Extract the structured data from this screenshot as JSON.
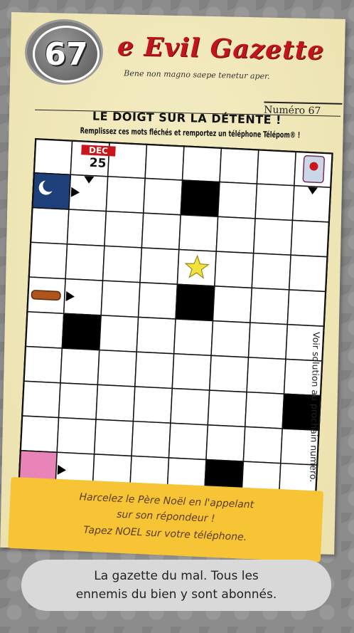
{
  "issue_badge": "67",
  "masthead": {
    "title": "e Evil Gazette",
    "motto": "Bene non magno saepe tenetur aper.",
    "issue": "Numéro 67"
  },
  "puzzle": {
    "headline": "LE DOIGT SUR LA DÉTENTE !",
    "instructions": "Remplissez ces mots fléchés et remportez un téléphone Télépom® !",
    "calendar_month": "DEC",
    "calendar_day": "25",
    "grid": {
      "cols": 8,
      "rows": 10,
      "black_cells": [
        [
          4,
          1
        ],
        [
          4,
          4
        ],
        [
          1,
          5
        ],
        [
          7,
          7
        ],
        [
          5,
          9
        ]
      ],
      "clue_cells": [
        {
          "col": 0,
          "row": 1,
          "kind": "moon"
        },
        {
          "col": 1,
          "row": 0,
          "kind": "calendar"
        },
        {
          "col": 7,
          "row": 0,
          "kind": "bouquet"
        },
        {
          "col": 4,
          "row": 3,
          "kind": "star"
        },
        {
          "col": 0,
          "row": 4,
          "kind": "log"
        },
        {
          "col": 0,
          "row": 9,
          "kind": "pink"
        }
      ],
      "colors": {
        "moon": "#1f3f7a",
        "star": "#f2e23a",
        "pink": "#e884b8",
        "calendar_red": "#c8161c"
      }
    },
    "side_note": "Voir solution au prochain numéro."
  },
  "promo": {
    "line1": "Harcelez le Père Noël en l'appelant",
    "line2": "sur son répondeur !",
    "line3": "Tapez NOEL sur votre téléphone."
  },
  "caption": {
    "line1": "La gazette du mal. Tous les",
    "line2": "ennemis du bien y sont abonnés."
  }
}
